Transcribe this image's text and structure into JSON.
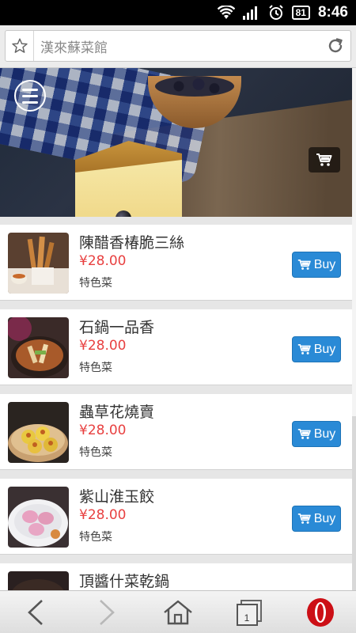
{
  "status_bar": {
    "battery": "81",
    "time": "8:46"
  },
  "address_bar": {
    "title": "漢來蘇菜館"
  },
  "items": [
    {
      "name": "陳醋香椿脆三絲",
      "price": "¥28.00",
      "tag": "特色菜",
      "buy_label": "Buy"
    },
    {
      "name": "石鍋一品香",
      "price": "¥28.00",
      "tag": "特色菜",
      "buy_label": "Buy"
    },
    {
      "name": "蟲草花燒賣",
      "price": "¥28.00",
      "tag": "特色菜",
      "buy_label": "Buy"
    },
    {
      "name": "紫山淮玉餃",
      "price": "¥28.00",
      "tag": "特色菜",
      "buy_label": "Buy"
    },
    {
      "name": "頂醬什菜乾鍋",
      "price": "",
      "tag": "",
      "buy_label": ""
    }
  ],
  "bottom_bar": {
    "tab_count": "1"
  },
  "colors": {
    "buy_button": "#2a8ad6",
    "price": "#e84040",
    "opera": "#cc0f16"
  }
}
